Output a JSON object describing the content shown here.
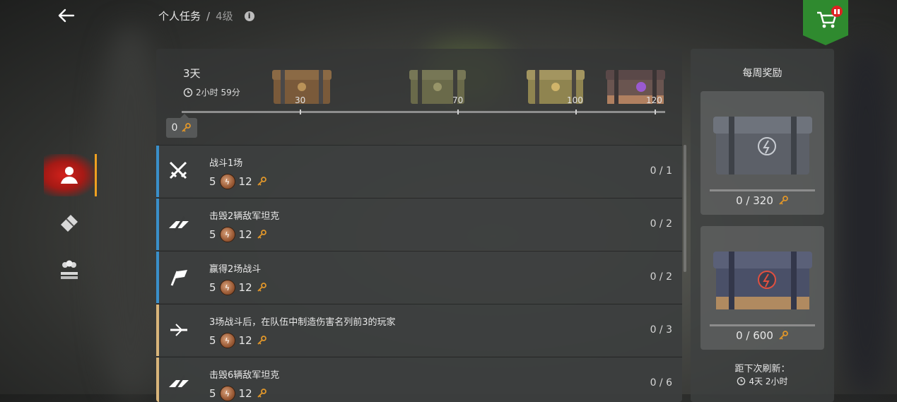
{
  "header": {
    "title": "个人任务",
    "separator": "/",
    "level": "4级"
  },
  "season": {
    "days": "3天",
    "timer": "2小时 59分",
    "current_points": "0"
  },
  "milestones": [
    {
      "label": "30",
      "chest": "wooden-chest"
    },
    {
      "label": "70",
      "chest": "green-chest"
    },
    {
      "label": "100",
      "chest": "gold-chest"
    },
    {
      "label": "120",
      "chest": "purple-chest"
    }
  ],
  "tasks": [
    {
      "name": "战斗1场",
      "credits": "5",
      "keys": "12",
      "progress": "0 / 1",
      "stripe": "#3a8fc9",
      "icon": "crossed-swords-icon"
    },
    {
      "name": "击毁2辆敌军坦克",
      "credits": "5",
      "keys": "12",
      "progress": "0 / 2",
      "stripe": "#3a8fc9",
      "icon": "tank-destroy-icon"
    },
    {
      "name": "赢得2场战斗",
      "credits": "5",
      "keys": "12",
      "progress": "0 / 2",
      "stripe": "#3a8fc9",
      "icon": "victory-flag-icon"
    },
    {
      "name": "3场战斗后，在队伍中制造伤害名列前3的玩家",
      "credits": "5",
      "keys": "12",
      "progress": "0 / 3",
      "stripe": "#d9b57a",
      "icon": "damage-icon"
    },
    {
      "name": "击毁6辆敌军坦克",
      "credits": "5",
      "keys": "12",
      "progress": "0 / 6",
      "stripe": "#d9b57a",
      "icon": "tank-destroy-icon"
    }
  ],
  "weekly": {
    "title": "每周奖励",
    "rewards": [
      {
        "progress": "0 / 320"
      },
      {
        "progress": "0 / 600"
      }
    ],
    "refresh_label": "距下次刷新：",
    "refresh_time": "4天 2小时"
  },
  "colors": {
    "accent_orange": "#f0a020",
    "active_red": "#c81e18",
    "shop_green": "#2f8a2f",
    "stripe_blue": "#3a8fc9",
    "stripe_gold": "#d9b57a"
  }
}
